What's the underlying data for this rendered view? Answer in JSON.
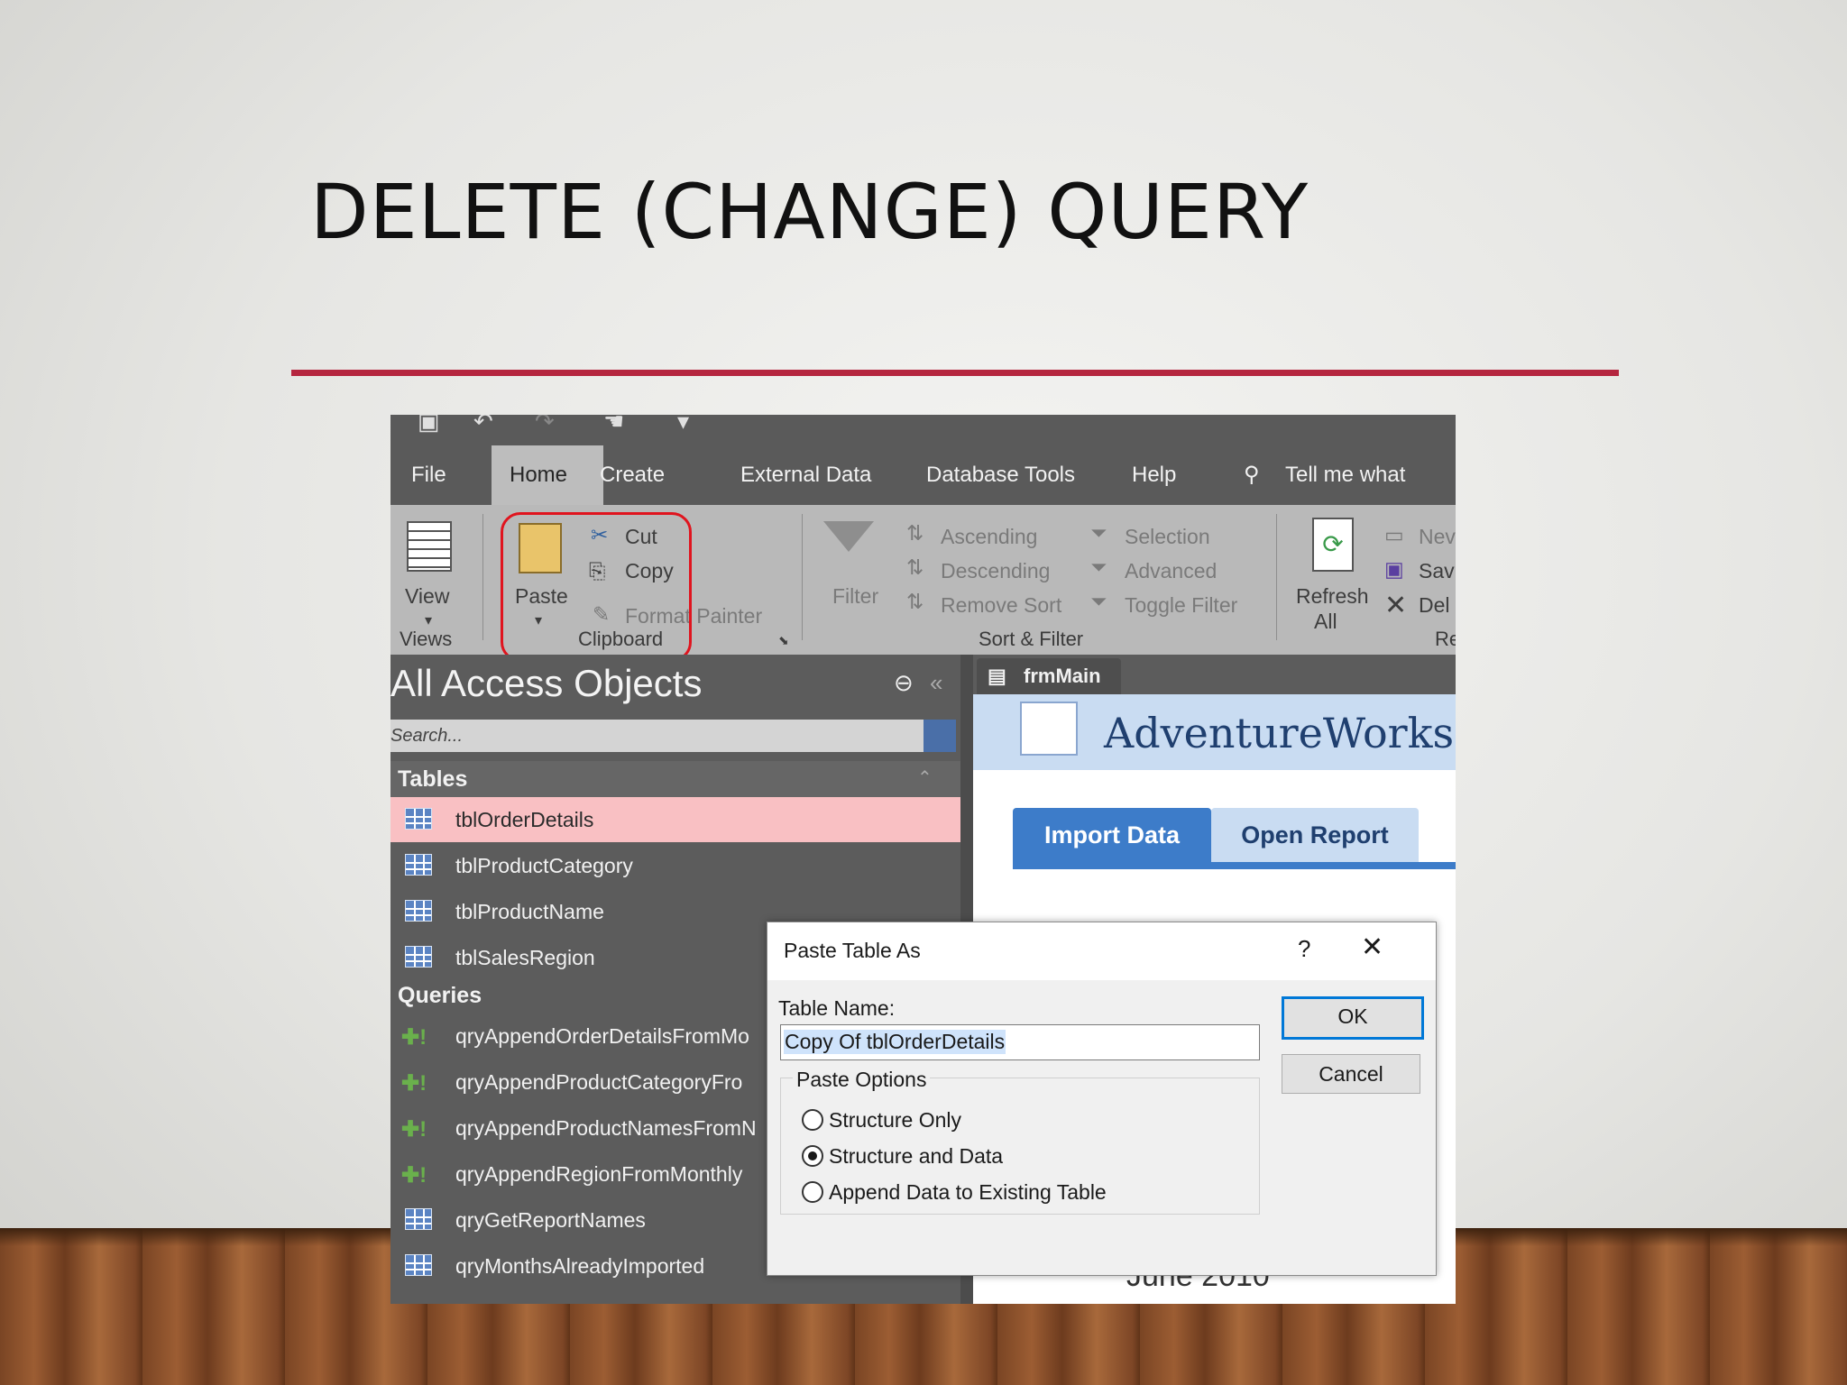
{
  "slide": {
    "title": "DELETE (CHANGE) QUERY"
  },
  "tabs": [
    "File",
    "Home",
    "Create",
    "External Data",
    "Database Tools",
    "Help",
    "Tell me what you"
  ],
  "ribbon": {
    "view": "View",
    "views_group": "Views",
    "paste": "Paste",
    "cut": "Cut",
    "copy": "Copy",
    "format_painter": "Format Painter",
    "clipboard_group": "Clipboard",
    "filter": "Filter",
    "ascending": "Ascending",
    "descending": "Descending",
    "remove_sort": "Remove Sort",
    "selection": "Selection",
    "advanced": "Advanced",
    "toggle_filter": "Toggle Filter",
    "sort_filter_group": "Sort & Filter",
    "refresh": "Refresh",
    "refresh_all": "All",
    "new": "Nev",
    "save": "Sav",
    "delete": "Del",
    "records_group": "Re"
  },
  "nav": {
    "title": "All Access Objects",
    "search_placeholder": "Search...",
    "tables_header": "Tables",
    "tables": [
      "tblOrderDetails",
      "tblProductCategory",
      "tblProductName",
      "tblSalesRegion"
    ],
    "queries_header": "Queries",
    "queries": [
      "qryAppendOrderDetailsFromMo",
      "qryAppendProductCategoryFro",
      "qryAppendProductNamesFromN",
      "qryAppendRegionFromMonthly",
      "qryGetReportNames",
      "qryMonthsAlreadyImported"
    ]
  },
  "document": {
    "tab": "frmMain",
    "brand": "AdventureWorks",
    "import_tab": "Import Data",
    "report_tab": "Open Report",
    "month": "June 2010"
  },
  "dialog": {
    "title": "Paste Table As",
    "help": "?",
    "close": "✕",
    "table_name_label": "Table Name:",
    "table_name_value": "Copy Of tblOrderDetails",
    "options_label": "Paste Options",
    "options": [
      "Structure Only",
      "Structure and Data",
      "Append Data to Existing Table"
    ],
    "selected_option": "Structure and Data",
    "ok": "OK",
    "cancel": "Cancel"
  },
  "colors": {
    "accent_rule": "#b5263f",
    "highlight_box": "#e0141e",
    "selected_row": "#f9c0c3",
    "ok_border": "#0078d7"
  }
}
